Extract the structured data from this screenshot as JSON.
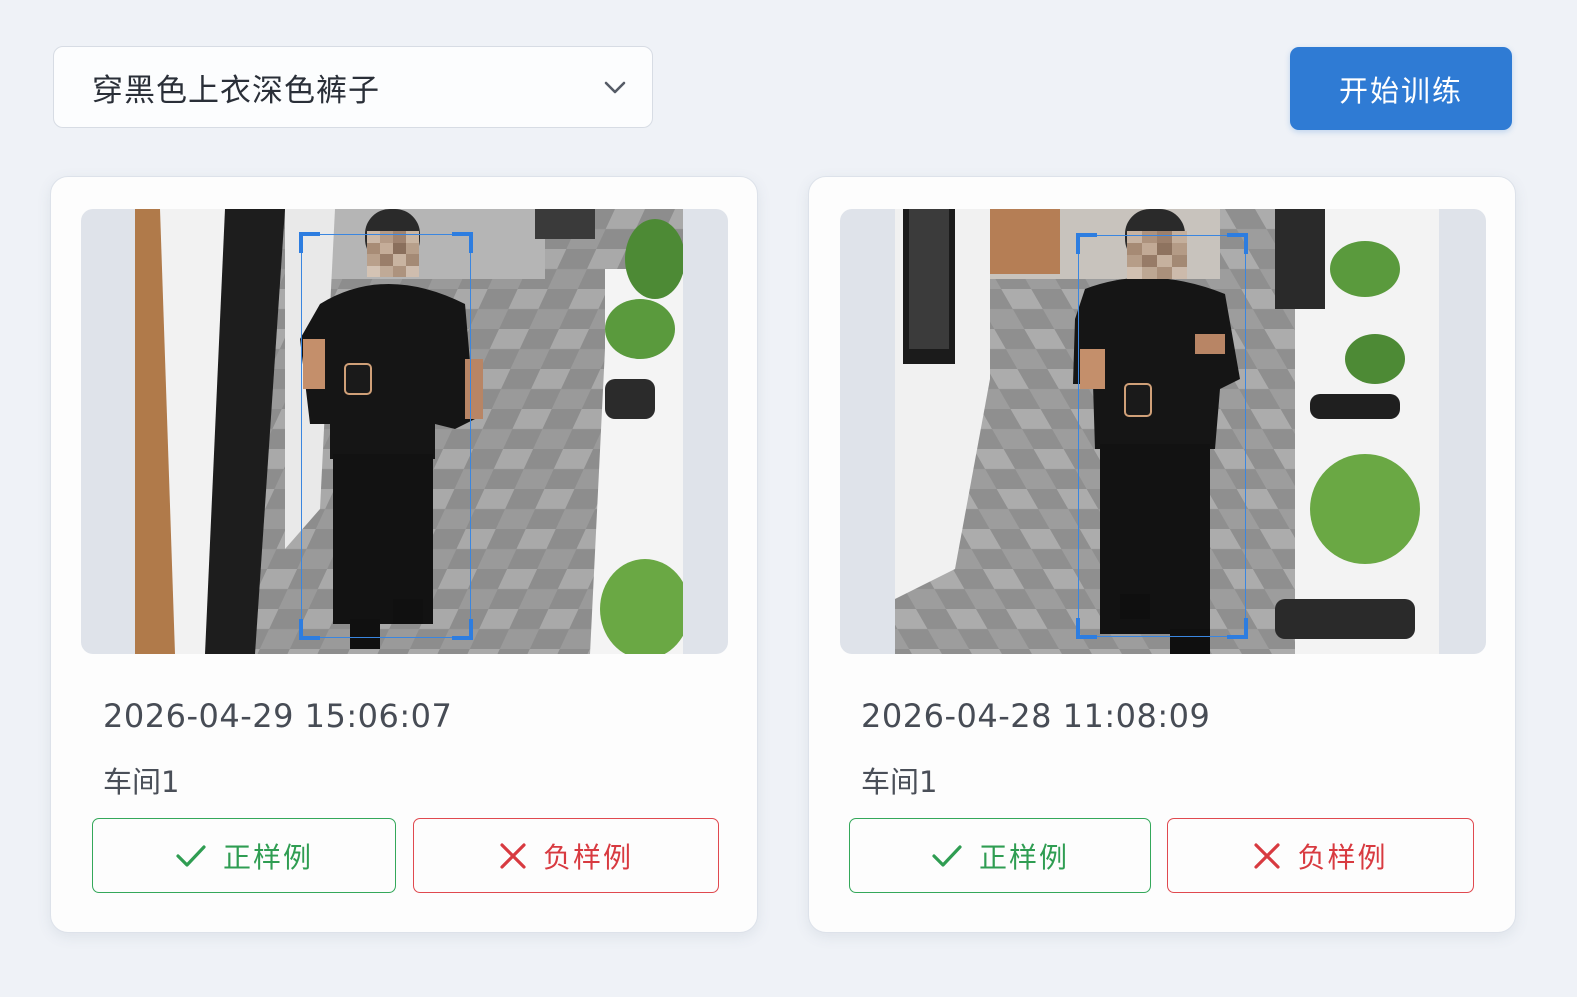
{
  "filter": {
    "selected": "穿黑色上衣深色裤子",
    "icon": "chevron-down-icon"
  },
  "toolbar": {
    "train_label": "开始训练"
  },
  "colors": {
    "primary": "#2f7bd4",
    "positive": "#2f9d52",
    "negative": "#d83a40",
    "bbox": "#2d7de0"
  },
  "cards": [
    {
      "timestamp": "2026-04-29 15:06:07",
      "location": "车间1",
      "positive_label": "正样例",
      "negative_label": "负样例",
      "image": "surveillance-snapshot"
    },
    {
      "timestamp": "2026-04-28 11:08:09",
      "location": "车间1",
      "positive_label": "正样例",
      "negative_label": "负样例",
      "image": "surveillance-snapshot"
    }
  ]
}
